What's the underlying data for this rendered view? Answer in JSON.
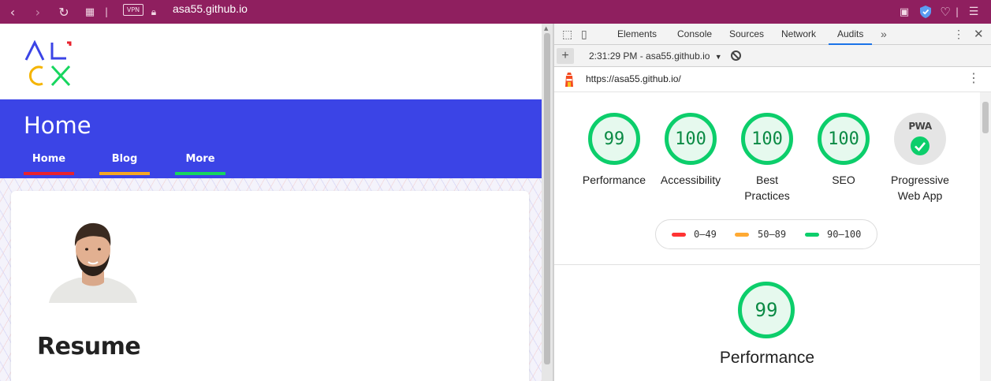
{
  "browser": {
    "vpn_label": "VPN",
    "url": "asa55.github.io",
    "icons": [
      "back-icon",
      "forward-icon",
      "reload-icon",
      "grid-icon",
      "lock-icon",
      "camera-icon",
      "shield-icon",
      "heart-icon",
      "menu-icon"
    ]
  },
  "page": {
    "title": "Home",
    "nav": [
      {
        "label": "Home",
        "color": "#e8222d"
      },
      {
        "label": "Blog",
        "color": "#f5a623"
      },
      {
        "label": "More",
        "color": "#17d65f"
      }
    ],
    "resume_heading": "Resume",
    "band_color": "#3b44e6"
  },
  "devtools": {
    "tabs": [
      "Elements",
      "Console",
      "Sources",
      "Network",
      "Audits"
    ],
    "active_tab": "Audits",
    "report_label": "2:31:29 PM - asa55.github.io",
    "audited_url": "https://asa55.github.io/",
    "scores": [
      {
        "value": "99",
        "label": "Performance"
      },
      {
        "value": "100",
        "label": "Accessibility"
      },
      {
        "value": "100",
        "label_line1": "Best",
        "label_line2": "Practices"
      },
      {
        "value": "100",
        "label": "SEO"
      }
    ],
    "pwa": {
      "badge_text": "PWA",
      "label_line1": "Progressive",
      "label_line2": "Web App"
    },
    "legend": [
      {
        "range": "0–49",
        "color": "#ff3333"
      },
      {
        "range": "50–89",
        "color": "#ffaa33"
      },
      {
        "range": "90–100",
        "color": "#0cce6b"
      }
    ],
    "section": {
      "value": "99",
      "label": "Performance"
    }
  }
}
